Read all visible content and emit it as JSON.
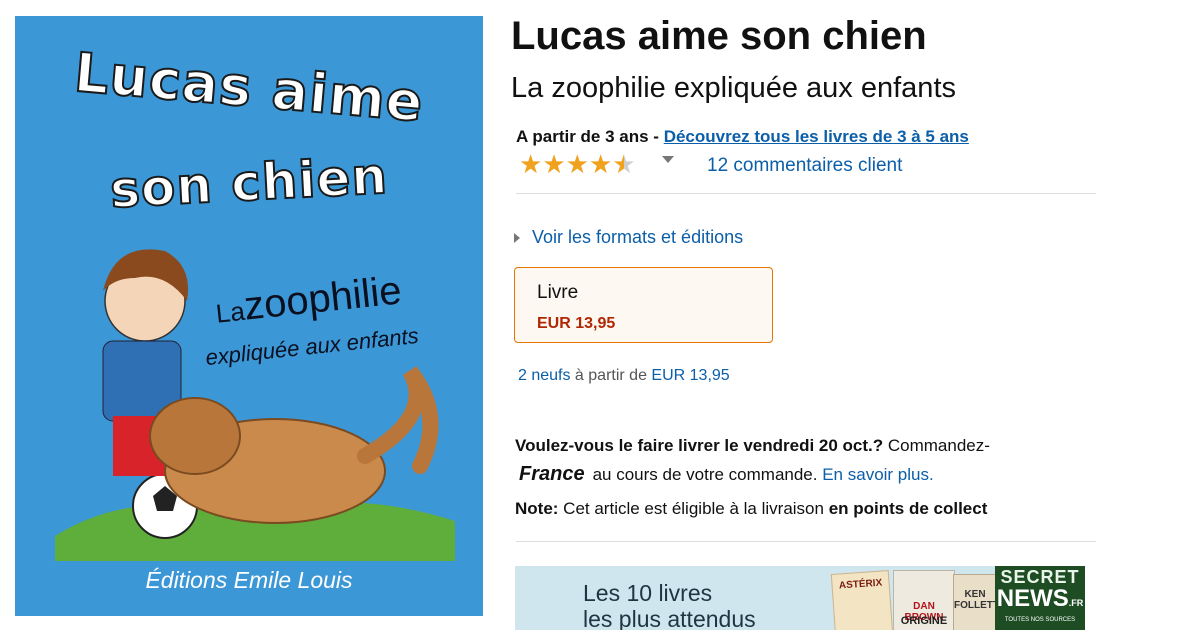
{
  "cover": {
    "title_line1": "Lucas aime",
    "title_line2": "son chien",
    "subtitle_la": "La",
    "subtitle_main": "zoophilie",
    "subtitle_rest": "expliquée aux enfants",
    "publisher": "Éditions Emile Louis"
  },
  "product": {
    "title": "Lucas aime son chien",
    "subtitle": "La zoophilie expliquée aux enfants",
    "age_prefix": "A partir de 3 ans - ",
    "age_link": "Découvrez tous les livres de 3 à 5 ans",
    "rating": 4.5,
    "reviews": "12 commentaires client",
    "formats_link": "Voir les formats et éditions",
    "format": {
      "name": "Livre",
      "price": "EUR 13,95"
    },
    "offers": {
      "count_link": "2 neufs",
      "middle": " à partir de ",
      "price_link": "EUR 13,95"
    },
    "delivery": {
      "question": "Voulez-vous le faire livrer le vendredi 20 oct.?",
      "cta": " Commandez-",
      "country": "France",
      "tail": "au cours de votre commande. ",
      "more_link": "En savoir plus."
    },
    "note": {
      "label": "Note:",
      "text": " Cet article est éligible à la livraison ",
      "bold": "en points de collect"
    }
  },
  "banner": {
    "line1": "Les 10 livres",
    "line2": "les plus attendus",
    "book1": "ASTÉRIX",
    "book2_line1": "DAN BROWN",
    "book2_line2": "ORIGINE",
    "book3": "KEN FOLLETT",
    "badge_line1": "SECRET",
    "badge_line2": "NEWS",
    "badge_suffix": ".FR",
    "badge_line3": "TOUTES NOS SOURCES"
  },
  "colors": {
    "cover_bg": "#3b97d6",
    "link": "#0b5ea8",
    "price": "#b12704",
    "star": "#f0a21e",
    "format_border": "#e77600"
  }
}
